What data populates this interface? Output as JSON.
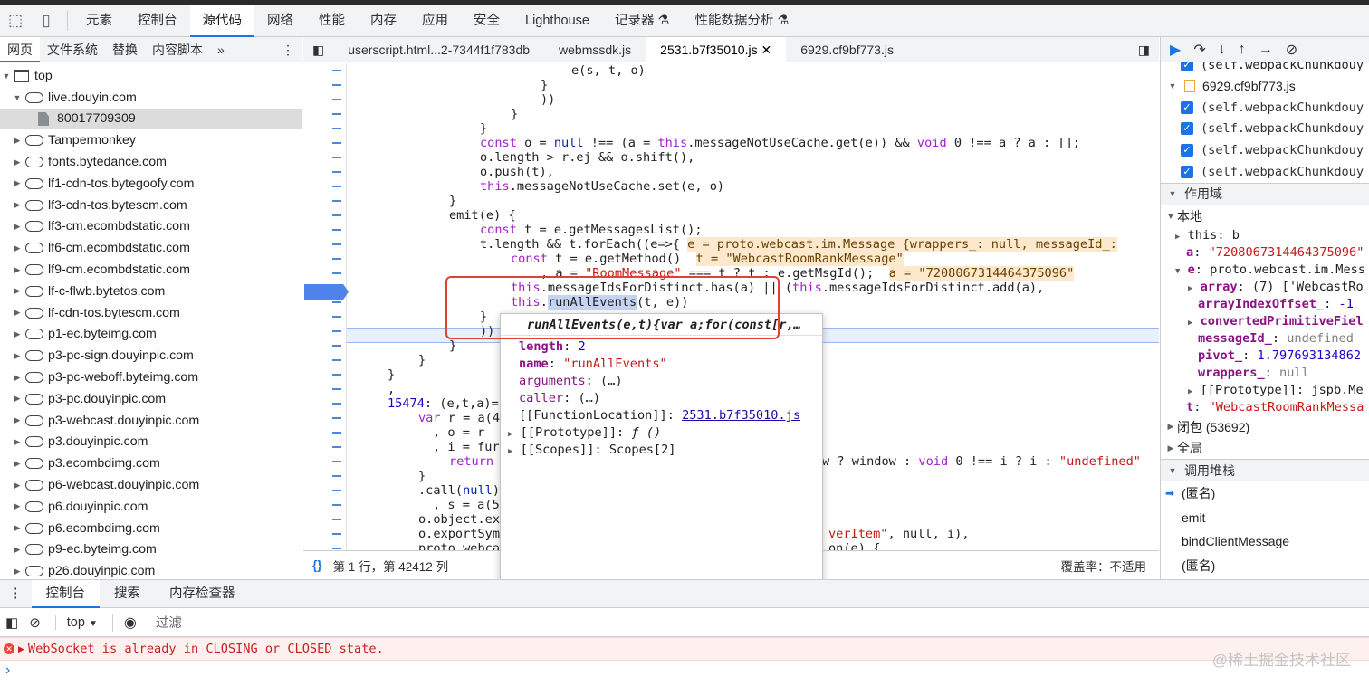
{
  "top_tabs": [
    "元素",
    "控制台",
    "源代码",
    "网络",
    "性能",
    "内存",
    "应用",
    "安全",
    "Lighthouse",
    "记录器",
    "性能数据分析"
  ],
  "left_subtabs": [
    "网页",
    "文件系统",
    "替换",
    "内容脚本"
  ],
  "tree": {
    "top": "top",
    "origin": "live.douyin.com",
    "file": "80017709309",
    "domains": [
      "Tampermonkey",
      "fonts.bytedance.com",
      "lf1-cdn-tos.bytegoofy.com",
      "lf3-cdn-tos.bytescm.com",
      "lf3-cm.ecombdstatic.com",
      "lf6-cm.ecombdstatic.com",
      "lf9-cm.ecombdstatic.com",
      "lf-c-flwb.bytetos.com",
      "lf-cdn-tos.bytescm.com",
      "p1-ec.byteimg.com",
      "p3-pc-sign.douyinpic.com",
      "p3-pc-weboff.byteimg.com",
      "p3-pc.douyinpic.com",
      "p3-webcast.douyinpic.com",
      "p3.douyinpic.com",
      "p3.ecombdimg.com",
      "p6-webcast.douyinpic.com",
      "p6.douyinpic.com",
      "p6.ecombdimg.com",
      "p9-ec.byteimg.com",
      "p26.douyinpic.com"
    ]
  },
  "file_tabs": [
    "userscript.html...2-7344f1f783db",
    "webmssdk.js",
    "2531.b7f35010.js",
    "6929.cf9bf773.js"
  ],
  "code": {
    "l1": "e(s, t, o)",
    "l2": "}",
    "l3": "))",
    "l4": "}",
    "l5": "}",
    "l6_kw": "const",
    "l6_a": " o = ",
    "l6_null": "null",
    "l6_b": " !== (a = ",
    "l6_this": "this",
    "l6_c": ".messageNotUseCache.get(e)) && ",
    "l6_void": "void",
    "l6_d": " 0 !== a ? a : [];",
    "l7": "o.length > r.ej && o.shift(),",
    "l8": "o.push(t),",
    "l9_this": "this",
    "l9_rest": ".messageNotUseCache.set(e, o)",
    "l10": "}",
    "l11": "emit(e) {",
    "l12_kw": "const",
    "l12_rest": " t = e.getMessagesList();",
    "l13": "t.length && t.forEach((e=>{",
    "l13_inline": "e = proto.webcast.im.Message {wrappers_: null, messageId_:",
    "l14_kw": "const",
    "l14_rest": " t = e.getMethod()",
    "l14_inline": "t = \"WebcastRoomRankMessage\"",
    "l15_a": ", a = ",
    "l15_str": "\"RoomMessage\"",
    "l15_b": " === t ? t : e.getMsgId();",
    "l15_inline": "a = \"7208067314464375096\"",
    "l16_this": "this",
    "l16_rest": ".messageIdsForDistinct.has(a) || (",
    "l16_this2": "this",
    "l16_rest2": ".messageIdsForDistinct.add(a),",
    "l17_this": "this",
    "l17_dot": ".",
    "l17_sel": "runAllEvents",
    "l17_rest": "(t, e))",
    "l18": "}",
    "l19": "))",
    "l20": "}",
    "l21": "}",
    "l22": "}",
    "l23": ",",
    "l24_num": "15474",
    "l24_rest": ": (e,t,a)=",
    "l25_kw": "var",
    "l25_rest": " r = a(4",
    "l26": ", o = r",
    "l27": ", i = fur",
    "l28_kw": "return",
    "l28_right_a": "w ? window : ",
    "l28_right_void": "void",
    "l28_right_b": " 0 !== i ? i : ",
    "l28_right_str": "\"undefined\"",
    "l29": "}",
    "l30_a": ".call(",
    "l30_null": "null",
    "l30_b": ")",
    "l31": ", s = a(5",
    "l32": "o.object.ex",
    "l33": "o.exportSym",
    "l33_right_str": "verItem\"",
    "l33_right_rest": ", null, i),",
    "l34": "proto.webca",
    "l34_right": "on(e) {"
  },
  "popup": {
    "signature": "runAllEvents(e,t){var a;for(const[r,…",
    "length_key": "length",
    "length_val": "2",
    "name_key": "name",
    "name_val": "\"runAllEvents\"",
    "arguments_key": "arguments",
    "arguments_val": "(…)",
    "caller_key": "caller",
    "caller_val": "(…)",
    "location_key": "[[FunctionLocation]]",
    "location_val": "2531.b7f35010.js",
    "proto_key": "[[Prototype]]",
    "proto_val": "ƒ ()",
    "scopes_key": "[[Scopes]]",
    "scopes_val": "Scopes[2]"
  },
  "editor_status": {
    "braces": "{}",
    "position": "第 1 行，第 42412 列",
    "coverage": "覆盖率：不适用"
  },
  "right": {
    "bp_top": "(self.webpackChunkdouy",
    "bp_file": "6929.cf9bf773.js",
    "bp_items": [
      "(self.webpackChunkdouy",
      "(self.webpackChunkdouy",
      "(self.webpackChunkdouy",
      "(self.webpackChunkdouy"
    ],
    "scope_header": "作用域",
    "local": "本地",
    "this_key": "this",
    "this_val": "b",
    "a_key": "a",
    "a_val": "\"7208067314464375096\"",
    "e_key": "e",
    "e_val": "proto.webcast.im.Mess",
    "array_key": "array",
    "array_val": "(7) ['WebcastRo",
    "offset_key": "arrayIndexOffset_",
    "offset_val": "-1",
    "converted_key": "convertedPrimitiveFiel",
    "msgid_key": "messageId_",
    "msgid_val": "undefined",
    "pivot_key": "pivot_",
    "pivot_val": "1.797693134862",
    "wrappers_key": "wrappers_",
    "wrappers_val": "null",
    "proto_key": "[[Prototype]]",
    "proto_val": "jspb.Me",
    "t_key": "t",
    "t_val": "\"WebcastRoomRankMessa",
    "closure": "闭包 (53692)",
    "global": "全局",
    "callstack_header": "调用堆栈",
    "frames": [
      "(匿名)",
      "emit",
      "bindClientMessage",
      "(匿名)"
    ]
  },
  "drawer_tabs": [
    "控制台",
    "搜索",
    "内存检查器"
  ],
  "console": {
    "context": "top",
    "filter_placeholder": "过滤",
    "error": "WebSocket is already in CLOSING or CLOSED state.",
    "prompt": "›"
  },
  "watermark": "@稀土掘金技术社区"
}
